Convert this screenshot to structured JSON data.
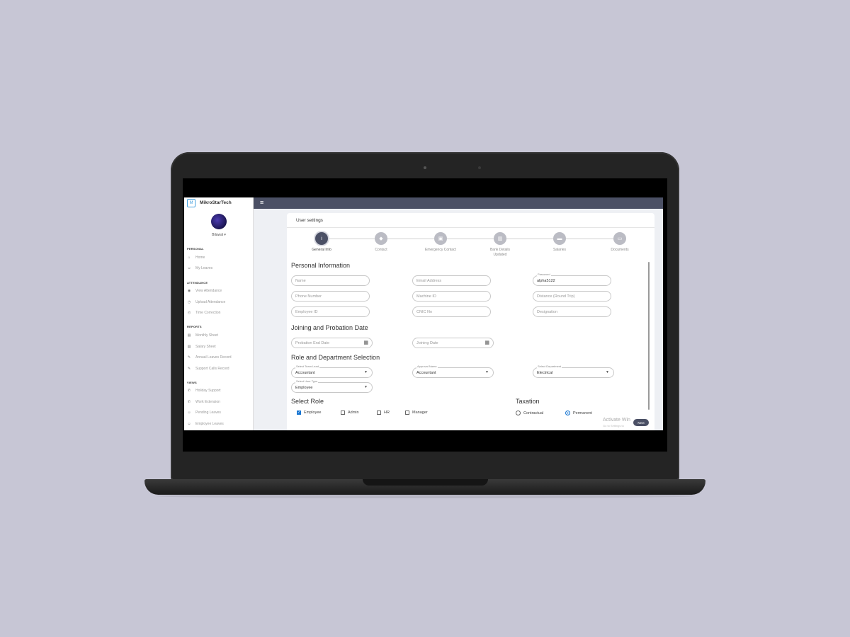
{
  "brand": {
    "name": "MikroStarTech",
    "logo_text": "M"
  },
  "user": {
    "name": "Bilawal"
  },
  "sidebar": {
    "sections": [
      {
        "title": "PERSONAL",
        "items": [
          {
            "label": "Home",
            "icon": "home-icon"
          },
          {
            "label": "My Leaves",
            "icon": "user-icon"
          }
        ]
      },
      {
        "title": "ATTENDANCE",
        "items": [
          {
            "label": "View Attendance",
            "icon": "eye-icon"
          },
          {
            "label": "Upload Attendance",
            "icon": "upload-icon"
          },
          {
            "label": "Time Correction",
            "icon": "clock-icon"
          }
        ]
      },
      {
        "title": "REPORTS",
        "items": [
          {
            "label": "Monthly Sheet",
            "icon": "document-icon"
          },
          {
            "label": "Salary Sheet",
            "icon": "document-icon"
          },
          {
            "label": "Annual Leaves Record",
            "icon": "document-icon"
          },
          {
            "label": "Support Calls Record",
            "icon": "phone-icon"
          }
        ]
      },
      {
        "title": "VIEWS",
        "items": [
          {
            "label": "Holiday Support",
            "icon": "phone-icon"
          },
          {
            "label": "Work Extension",
            "icon": "phone-icon"
          },
          {
            "label": "Pending Leaves",
            "icon": "users-icon"
          },
          {
            "label": "Employee Leaves",
            "icon": "users-icon"
          }
        ]
      }
    ]
  },
  "card": {
    "title": "User settings"
  },
  "steps": [
    {
      "label": "General Info",
      "icon": "info-icon"
    },
    {
      "label": "Contact",
      "icon": "contact-icon"
    },
    {
      "label": "Emergency Contact",
      "icon": "id-card-icon"
    },
    {
      "label": "Bank Details\nUpdated",
      "icon": "bank-icon"
    },
    {
      "label": "Salaries",
      "icon": "money-icon"
    },
    {
      "label": "Documents",
      "icon": "folder-icon"
    }
  ],
  "personal": {
    "heading": "Personal Information",
    "name_placeholder": "Name",
    "email_placeholder": "Email Address",
    "password_label": "Password",
    "password_value": "alpha5122",
    "phone_placeholder": "Phone Number",
    "machine_placeholder": "Machine ID",
    "distance_placeholder": "Distance (Round Trip)",
    "employee_id_placeholder": "Employee ID",
    "cnic_placeholder": "CNIC No",
    "designation_placeholder": "Designation"
  },
  "joining": {
    "heading": "Joining and Probation Date",
    "probation_placeholder": "Probation End Date",
    "joining_placeholder": "Joining Date"
  },
  "role_dept": {
    "heading": "Role and Department Selection",
    "team_lead_label": "Select Team Lead",
    "team_lead_value": "Accountant",
    "approver_label": "Approval Name",
    "approver_value": "Accountant",
    "department_label": "Select Department",
    "department_value": "Electrical",
    "user_type_label": "Select User Type",
    "user_type_value": "Employee"
  },
  "select_role": {
    "heading": "Select Role",
    "options": [
      "Employee",
      "Admin",
      "HR",
      "Manager"
    ],
    "checked": [
      "Employee"
    ]
  },
  "taxation": {
    "heading": "Taxation",
    "options": [
      "Contractual",
      "Permanent"
    ],
    "selected": "Permanent"
  },
  "watermark": {
    "title": "Activate Win",
    "subtitle": "Go to Settings to"
  },
  "next_label": "Next"
}
